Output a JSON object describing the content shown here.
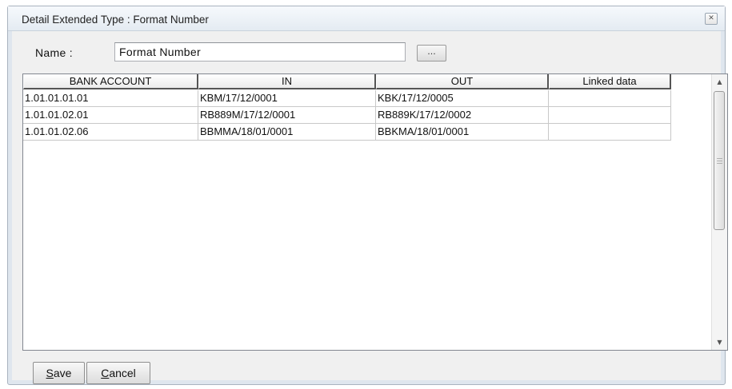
{
  "window": {
    "title": "Detail Extended Type : Format Number",
    "close_glyph": "✕"
  },
  "name_field": {
    "label": "Name :",
    "value": "Format Number",
    "browse_label": "..."
  },
  "grid": {
    "columns": [
      "BANK ACCOUNT",
      "IN",
      "OUT",
      "Linked data"
    ],
    "rows": [
      [
        "1.01.01.01.01",
        "KBM/17/12/0001",
        "KBK/17/12/0005",
        ""
      ],
      [
        "1.01.01.02.01",
        "RB889M/17/12/0001",
        "RB889K/17/12/0002",
        ""
      ],
      [
        "1.01.01.02.06",
        "BBMMA/18/01/0001",
        "BBKMA/18/01/0001",
        ""
      ]
    ]
  },
  "buttons": {
    "save_mnemonic": "S",
    "save_rest": "ave",
    "cancel_mnemonic": "C",
    "cancel_rest": "ancel"
  },
  "icons": {
    "scroll_up": "chevron-up-icon",
    "scroll_down": "chevron-down-icon",
    "close": "close-icon"
  }
}
